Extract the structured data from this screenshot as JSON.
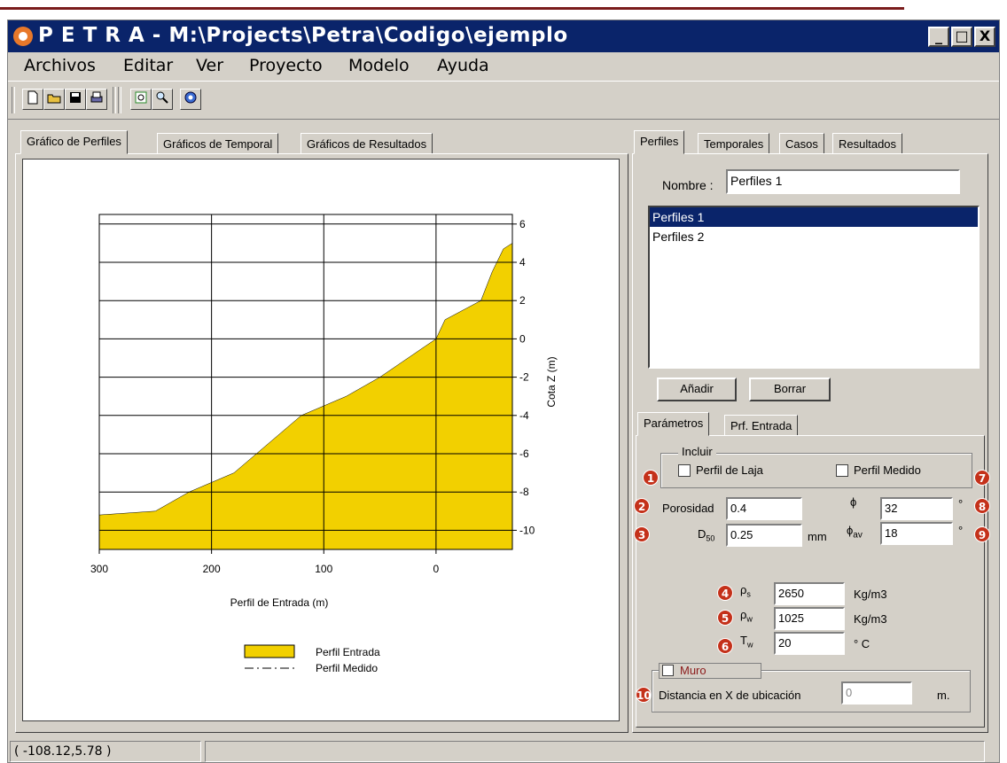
{
  "app": {
    "title": "P E T R A - M:\\Projects\\Petra\\Codigo\\ejemplo",
    "window_buttons": {
      "minimize": "_",
      "maximize": "□",
      "close": "X"
    }
  },
  "menu": [
    "Archivos",
    "Editar",
    "Ver",
    "Proyecto",
    "Modelo",
    "Ayuda"
  ],
  "toolbar": {
    "icons": [
      "new-file-icon",
      "open-folder-icon",
      "save-disk-icon",
      "print-icon",
      "print-preview-icon",
      "zoom-icon",
      "settings-gear-icon"
    ]
  },
  "left_tabs": [
    "Gráfico de Perfiles",
    "Gráficos de Temporal",
    "Gráficos de Resultados"
  ],
  "right_tabs": [
    "Perfiles",
    "Temporales",
    "Casos",
    "Resultados"
  ],
  "perfiles": {
    "nombre_label": "Nombre :",
    "nombre_value": "Perfiles 1",
    "items": [
      "Perfiles 1",
      "Perfiles 2"
    ],
    "selected_index": 0,
    "add_button": "Añadir",
    "delete_button": "Borrar"
  },
  "param_tabs": [
    "Parámetros",
    "Prf. Entrada"
  ],
  "parametros": {
    "incluir_label": "Incluir",
    "perfil_laja_label": "Perfil de Laja",
    "perfil_laja_checked": false,
    "perfil_medido_label": "Perfil Medido",
    "perfil_medido_checked": false,
    "porosidad_label": "Porosidad",
    "porosidad_value": "0.4",
    "d50_label": "D",
    "d50_sub": "50",
    "d50_value": "0.25",
    "d50_unit": "mm",
    "phi_label": "ϕ",
    "phi_value": "32",
    "phi_unit": "°",
    "phi_av_label": "ϕ",
    "phi_av_sub": "av",
    "phi_av_value": "18",
    "phi_av_unit": "°",
    "rho_s_label": "ρ",
    "rho_s_sub": "s",
    "rho_s_value": "2650",
    "rho_s_unit": "Kg/m3",
    "rho_w_label": "ρ",
    "rho_w_sub": "w",
    "rho_w_value": "1025",
    "rho_w_unit": "Kg/m3",
    "t_w_label": "T",
    "t_w_sub": "w",
    "t_w_value": "20",
    "t_w_unit": "° C",
    "muro_label": "Muro",
    "muro_checked": false,
    "distancia_label": "Distancia en X de ubicación",
    "distancia_value": "0",
    "distancia_unit": "m."
  },
  "markers": [
    "1",
    "2",
    "3",
    "4",
    "5",
    "6",
    "7",
    "8",
    "9",
    "10"
  ],
  "status": {
    "coords": "( -108.12,5.78 )"
  },
  "colors": {
    "fill": "#f2d000",
    "title_bar": "#0a246a",
    "marker": "#c4311a",
    "muro": "#8b1a1a"
  },
  "chart_data": {
    "type": "area",
    "title": "",
    "xlabel": "Perfil de Entrada  (m)",
    "ylabel": "Cota Z (m)",
    "x_reversed": true,
    "xlim": [
      -68,
      300
    ],
    "ylim": [
      -11,
      6.5
    ],
    "x_ticks": [
      "300",
      "200",
      "100",
      "0"
    ],
    "x_tick_values": [
      300,
      200,
      100,
      0
    ],
    "y_ticks": [
      "6",
      "4",
      "2",
      "0",
      "-2",
      "-4",
      "-6",
      "-8",
      "-10"
    ],
    "y_tick_values": [
      6,
      4,
      2,
      0,
      -2,
      -4,
      -6,
      -8,
      -10
    ],
    "grid": true,
    "legend": "bottom-center",
    "series": [
      {
        "name": "Perfil Entrada",
        "style": "filled",
        "x": [
          300,
          250,
          220,
          180,
          150,
          120,
          80,
          50,
          30,
          10,
          0,
          -8,
          -40,
          -50,
          -60,
          -68
        ],
        "y": [
          -9.2,
          -9.0,
          -8.0,
          -7.0,
          -5.5,
          -4.0,
          -3.0,
          -2.0,
          -1.2,
          -0.4,
          0.0,
          1.0,
          2.0,
          3.5,
          4.7,
          5.0
        ]
      },
      {
        "name": "Perfil Medido",
        "style": "dash-dot",
        "x": [],
        "y": []
      }
    ]
  }
}
